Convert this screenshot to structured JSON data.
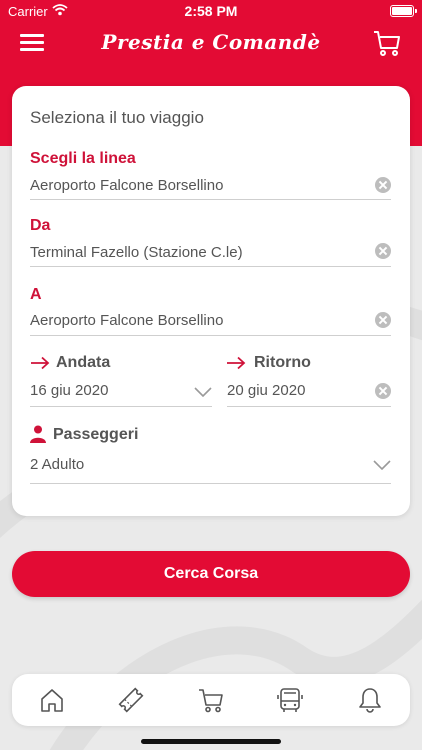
{
  "status_bar": {
    "carrier": "Carrier",
    "time": "2:58 PM"
  },
  "header": {
    "logo": "Prestia e Comandè",
    "menu_icon": "hamburger-icon",
    "cart_icon": "cart-icon",
    "brand_color": "#e30b34"
  },
  "form": {
    "title": "Seleziona il tuo viaggio",
    "line": {
      "label": "Scegli la linea",
      "value": "Aeroporto Falcone Borsellino"
    },
    "from": {
      "label": "Da",
      "value": "Terminal Fazello (Stazione C.le)"
    },
    "to": {
      "label": "A",
      "value": "Aeroporto Falcone Borsellino"
    },
    "departure": {
      "label": "Andata",
      "value": "16 giu 2020"
    },
    "return": {
      "label": "Ritorno",
      "value": "20 giu 2020"
    },
    "passengers": {
      "label": "Passeggeri",
      "value": "2 Adulto"
    }
  },
  "search_button": {
    "label": "Cerca Corsa"
  },
  "tab_bar": {
    "items": [
      {
        "icon": "home-icon"
      },
      {
        "icon": "ticket-icon"
      },
      {
        "icon": "cart-icon"
      },
      {
        "icon": "bus-icon"
      },
      {
        "icon": "bell-icon"
      }
    ]
  }
}
